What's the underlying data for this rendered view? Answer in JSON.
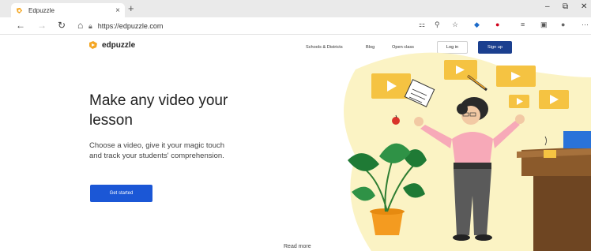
{
  "browser": {
    "tab_title": "Edpuzzle",
    "tab_close": "×",
    "new_tab": "+",
    "url": "https://edpuzzle.com",
    "window_controls": [
      "–",
      "⧉",
      "✕"
    ]
  },
  "site": {
    "logo_text": "edpuzzle",
    "nav": [
      "Schools & Districts",
      "Blog",
      "Open class"
    ],
    "login_label": "Log in",
    "signup_label": "Sign up",
    "headline": "Make any video your lesson",
    "subtext": "Choose a video, give it your magic touch and track your students' comprehension.",
    "cta_label": "Get started",
    "read_more": "Read more"
  },
  "colors": {
    "brand_blue": "#1b3f8f",
    "cta_blue": "#1b57d6",
    "accent_yellow": "#f5c342",
    "illustration_pink": "#f7a9b8"
  }
}
